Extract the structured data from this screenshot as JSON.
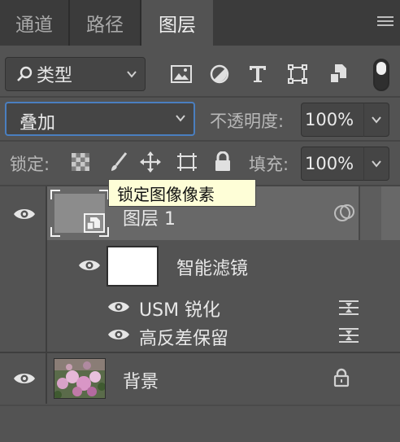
{
  "tabs": [
    {
      "label": "通道",
      "active": false
    },
    {
      "label": "路径",
      "active": false
    },
    {
      "label": "图层",
      "active": true
    }
  ],
  "filter": {
    "label": "类型",
    "icons": [
      "image-filter-icon",
      "adjustment-filter-icon",
      "type-filter-icon",
      "shape-filter-icon",
      "smart-object-filter-icon"
    ]
  },
  "blend": {
    "mode": "叠加",
    "opacity_label": "不透明度:",
    "opacity_value": "100%"
  },
  "lock": {
    "label": "锁定:",
    "fill_label": "填充:",
    "fill_value": "100%",
    "tooltip": "锁定图像像素"
  },
  "layers": [
    {
      "name": "图层 1",
      "type": "smart-object",
      "selected": true
    },
    {
      "name": "智能滤镜",
      "type": "smart-filter-mask"
    },
    {
      "name": "USM 锐化",
      "type": "filter"
    },
    {
      "name": "高反差保留",
      "type": "filter"
    },
    {
      "name": "背景",
      "type": "background",
      "locked": true
    }
  ],
  "colors": {
    "panel_bg": "#535353",
    "tab_bar_bg": "#3b3b3b",
    "selected_row": "#686868",
    "focus_blue": "#4a7fc0",
    "tooltip_bg": "#fefed7"
  }
}
